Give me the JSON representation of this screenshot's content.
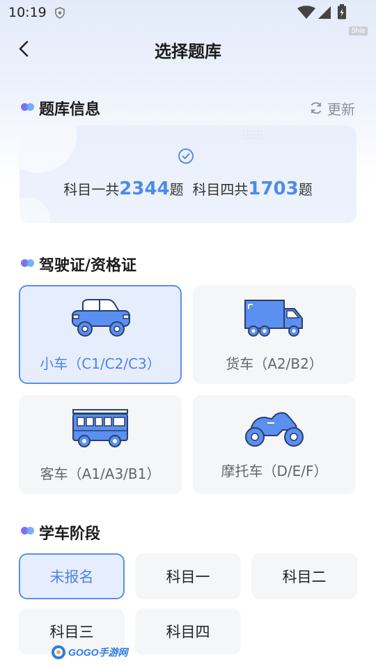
{
  "status_bar": {
    "time": "10:19"
  },
  "watermark": "5hla",
  "header": {
    "title": "选择题库"
  },
  "bank_info": {
    "section_title": "题库信息",
    "update_label": "更新",
    "subject1_prefix": "科目一共",
    "subject1_count": "2344",
    "subject1_suffix": "题",
    "subject4_prefix": "科目四共",
    "subject4_count": "1703",
    "subject4_suffix": "题"
  },
  "license": {
    "section_title": "驾驶证/资格证",
    "options": [
      {
        "label": "小车（C1/C2/C3）",
        "icon": "car-icon",
        "selected": true
      },
      {
        "label": "货车（A2/B2）",
        "icon": "truck-icon",
        "selected": false
      },
      {
        "label": "客车（A1/A3/B1）",
        "icon": "bus-icon",
        "selected": false
      },
      {
        "label": "摩托车（D/E/F）",
        "icon": "motorcycle-icon",
        "selected": false
      }
    ]
  },
  "stage": {
    "section_title": "学车阶段",
    "options": [
      {
        "label": "未报名",
        "selected": true
      },
      {
        "label": "科目一",
        "selected": false
      },
      {
        "label": "科目二",
        "selected": false
      },
      {
        "label": "科目三",
        "selected": false
      },
      {
        "label": "科目四",
        "selected": false
      }
    ]
  },
  "footer_logo": {
    "text": "GOGO手游网"
  },
  "colors": {
    "accent": "#4e82ea",
    "selected_bg": "#e6eefd",
    "card_bg": "#f5f6f8",
    "vehicle_blue": "#5b8ff0"
  }
}
